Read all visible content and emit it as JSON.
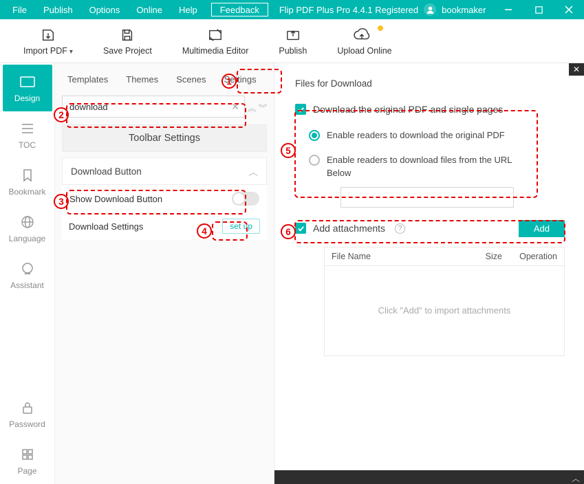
{
  "menu": {
    "file": "File",
    "publish": "Publish",
    "options": "Options",
    "online": "Online",
    "help": "Help"
  },
  "feedback": "Feedback",
  "appTitle": "Flip PDF Plus Pro 4.4.1 Registered",
  "user": "bookmaker",
  "toolbar": {
    "import": "Import PDF",
    "save": "Save Project",
    "multimedia": "Multimedia Editor",
    "publish": "Publish",
    "upload": "Upload Online"
  },
  "side": {
    "design": "Design",
    "toc": "TOC",
    "bookmark": "Bookmark",
    "language": "Language",
    "assistant": "Assistant",
    "password": "Password",
    "page": "Page"
  },
  "tabs": {
    "templates": "Templates",
    "themes": "Themes",
    "scenes": "Scenes",
    "settings": "Settings"
  },
  "search": {
    "value": "download"
  },
  "section": {
    "toolbar": "Toolbar Settings",
    "downloadBtn": "Download Button",
    "showDownload": "Show Download Button",
    "downloadSettings": "Download Settings",
    "setup": "set up"
  },
  "right": {
    "title": "Files for Download",
    "sec1": "Download the original PDF and single pages",
    "r1": "Enable readers to download the original PDF",
    "r2": "Enable readers to download files from the URL Below",
    "sec2": "Add attachments",
    "add": "Add",
    "th": {
      "file": "File Name",
      "size": "Size",
      "op": "Operation"
    },
    "empty": "Click \"Add\" to import attachments"
  }
}
